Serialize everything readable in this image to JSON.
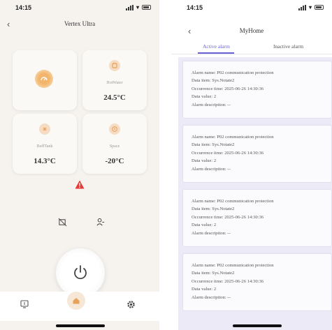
{
  "left": {
    "status": {
      "time": "14:15"
    },
    "title": "Vertex Ultra",
    "tiles": [
      {
        "label": "",
        "value": "",
        "icon": "gauge-icon"
      },
      {
        "label": "HotWater",
        "value": "24.5°C",
        "icon": "water-heater-icon"
      },
      {
        "label": "BuffTank",
        "value": "14.3°C",
        "icon": "buffer-tank-icon"
      },
      {
        "label": "Space",
        "value": "-20°C",
        "icon": "thermometer-icon"
      }
    ],
    "colors": {
      "accent": "#e8a05a",
      "icon_bg": "#f5dcc2",
      "warning": "#e53935"
    },
    "tabbar": {
      "left_icon": "device-icon",
      "center_icon": "home-icon",
      "right_icon": "gear-icon"
    }
  },
  "right": {
    "status": {
      "time": "14:15"
    },
    "title": "MyHome",
    "tabs": {
      "active": "Active alarm",
      "inactive": "Inactive alarm"
    },
    "colors": {
      "accent": "#6a63d8"
    },
    "alarms": [
      {
        "name": "Alarm name: P02 communication protection",
        "item": "Data item: Sys.Notate2",
        "time": "Occurrence time: 2025-06-26 14:30:36",
        "value": "Data value: 2",
        "desc": "Alarm description: --"
      },
      {
        "name": "Alarm name: P02 communication protection",
        "item": "Data item: Sys.Notate2",
        "time": "Occurrence time: 2025-06-26 14:30:36",
        "value": "Data value: 2",
        "desc": "Alarm description: --"
      },
      {
        "name": "Alarm name: P02 communication protection",
        "item": "Data item: Sys.Notate2",
        "time": "Occurrence time: 2025-06-26 14:30:36",
        "value": "Data value: 2",
        "desc": "Alarm description: --"
      },
      {
        "name": "Alarm name: P02 communication protection",
        "item": "Data item: Sys.Notate2",
        "time": "Occurrence time: 2025-06-26 14:30:36",
        "value": "Data value: 2",
        "desc": "Alarm description: --"
      }
    ]
  }
}
